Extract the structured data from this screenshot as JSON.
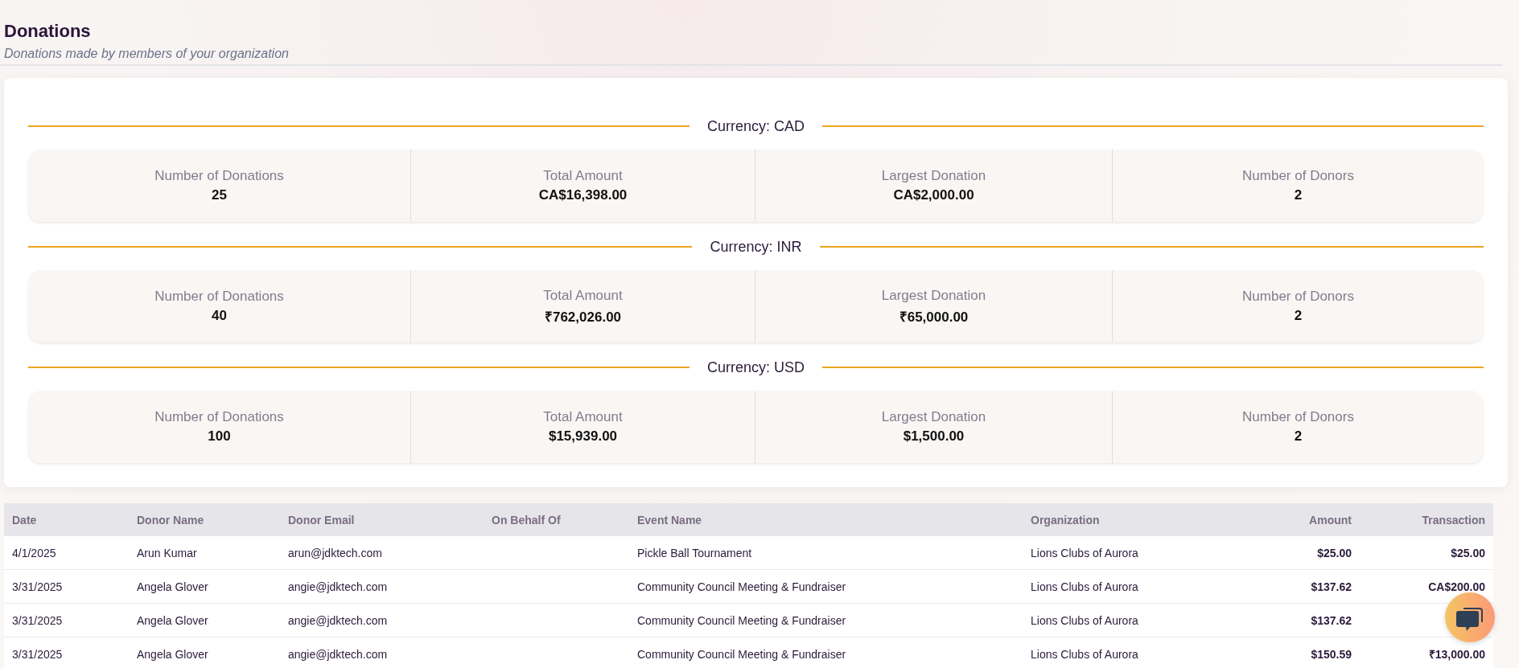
{
  "page": {
    "title": "Donations",
    "subtitle": "Donations made by members of your organization"
  },
  "currencies": [
    {
      "label": "Currency: CAD",
      "stats": [
        {
          "label": "Number of Donations",
          "value": "25"
        },
        {
          "label": "Total Amount",
          "value": "CA$16,398.00"
        },
        {
          "label": "Largest Donation",
          "value": "CA$2,000.00"
        },
        {
          "label": "Number of Donors",
          "value": "2"
        }
      ]
    },
    {
      "label": "Currency: INR",
      "stats": [
        {
          "label": "Number of Donations",
          "value": "40"
        },
        {
          "label": "Total Amount",
          "value": "₹762,026.00"
        },
        {
          "label": "Largest Donation",
          "value": "₹65,000.00"
        },
        {
          "label": "Number of Donors",
          "value": "2"
        }
      ]
    },
    {
      "label": "Currency: USD",
      "stats": [
        {
          "label": "Number of Donations",
          "value": "100"
        },
        {
          "label": "Total Amount",
          "value": "$15,939.00"
        },
        {
          "label": "Largest Donation",
          "value": "$1,500.00"
        },
        {
          "label": "Number of Donors",
          "value": "2"
        }
      ]
    }
  ],
  "table": {
    "columns": [
      "Date",
      "Donor Name",
      "Donor Email",
      "On Behalf Of",
      "Event Name",
      "Organization",
      "Amount",
      "Transaction"
    ],
    "rows": [
      [
        "4/1/2025",
        "Arun Kumar",
        "arun@jdktech.com",
        "",
        "Pickle Ball Tournament",
        "Lions Clubs of Aurora",
        "$25.00",
        "$25.00"
      ],
      [
        "3/31/2025",
        "Angela Glover",
        "angie@jdktech.com",
        "",
        "Community Council Meeting & Fundraiser",
        "Lions Clubs of Aurora",
        "$137.62",
        "CA$200.00"
      ],
      [
        "3/31/2025",
        "Angela Glover",
        "angie@jdktech.com",
        "",
        "Community Council Meeting & Fundraiser",
        "Lions Clubs of Aurora",
        "$137.62",
        ""
      ],
      [
        "3/31/2025",
        "Angela Glover",
        "angie@jdktech.com",
        "",
        "Community Council Meeting & Fundraiser",
        "Lions Clubs of Aurora",
        "$150.59",
        "₹13,000.00"
      ]
    ]
  }
}
